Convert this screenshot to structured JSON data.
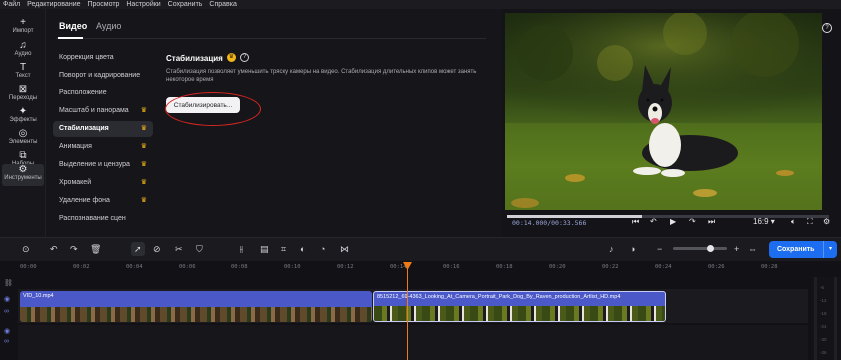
{
  "menu": [
    "Файл",
    "Редактирование",
    "Просмотр",
    "Настройки",
    "Сохранить",
    "Справка"
  ],
  "sidebar": [
    {
      "icon": "plus-icon",
      "glyph": "+",
      "label": "Импорт"
    },
    {
      "icon": "music-note-icon",
      "glyph": "♫",
      "label": "Аудио"
    },
    {
      "icon": "text-icon",
      "glyph": "T",
      "label": "Текст"
    },
    {
      "icon": "transitions-icon",
      "glyph": "⊠",
      "label": "Переходы"
    },
    {
      "icon": "sparkle-icon",
      "glyph": "✦",
      "label": "Эффекты"
    },
    {
      "icon": "elements-icon",
      "glyph": "◎",
      "label": "Элементы"
    },
    {
      "icon": "sets-icon",
      "glyph": "⧉",
      "label": "Наборы"
    },
    {
      "icon": "tools-icon",
      "glyph": "⚙",
      "label": "Инструменты"
    }
  ],
  "panel": {
    "tabs": [
      "Видео",
      "Аудио"
    ],
    "categories": [
      {
        "label": "Коррекция цвета",
        "premium": false
      },
      {
        "label": "Поворот и кадрирование",
        "premium": false
      },
      {
        "label": "Расположение",
        "premium": false
      },
      {
        "label": "Масштаб и панорама",
        "premium": true
      },
      {
        "label": "Стабилизация",
        "premium": true
      },
      {
        "label": "Анимация",
        "premium": true
      },
      {
        "label": "Выделение и цензура",
        "premium": true
      },
      {
        "label": "Хромакей",
        "premium": true
      },
      {
        "label": "Удаление фона",
        "premium": true
      },
      {
        "label": "Распознавание сцен",
        "premium": false
      }
    ],
    "stabilization": {
      "title": "Стабилизация",
      "description": "Стабилизация позволяет уменьшить тряску камеры на видео. Стабилизация длительных клипов может занять некоторое время",
      "button": "Стабилизировать..."
    }
  },
  "player": {
    "current_time": "00:14.000",
    "total_time": "00:33.566",
    "timecode": "00:14.000/00:33.566",
    "aspect": "16:9",
    "progress": 0.42
  },
  "toolbar": {
    "save_label": "Сохранить"
  },
  "timeline": {
    "ticks": [
      "00:00",
      "00:02",
      "00:04",
      "00:06",
      "00:08",
      "00:10",
      "00:12",
      "00:14",
      "00:16",
      "00:18",
      "00:20",
      "00:22",
      "00:24",
      "00:26",
      "00:28"
    ],
    "clips": [
      {
        "name": "VID_10.mp4",
        "color": "#4a58c8"
      },
      {
        "name": "8515212_69-4363_Looking_At_Camera_Portrait_Park_Dog_By_Raven_production_Artlist_HD.mp4",
        "color": "#4a58c8"
      }
    ],
    "vu_labels": [
      "-6",
      "-12",
      "-18",
      "-24",
      "-30",
      "-36"
    ]
  },
  "colors": {
    "accent": "#1c6df0",
    "premium": "#f2b61a",
    "playhead": "#f07a1a",
    "highlight_circle": "#d8261f"
  }
}
